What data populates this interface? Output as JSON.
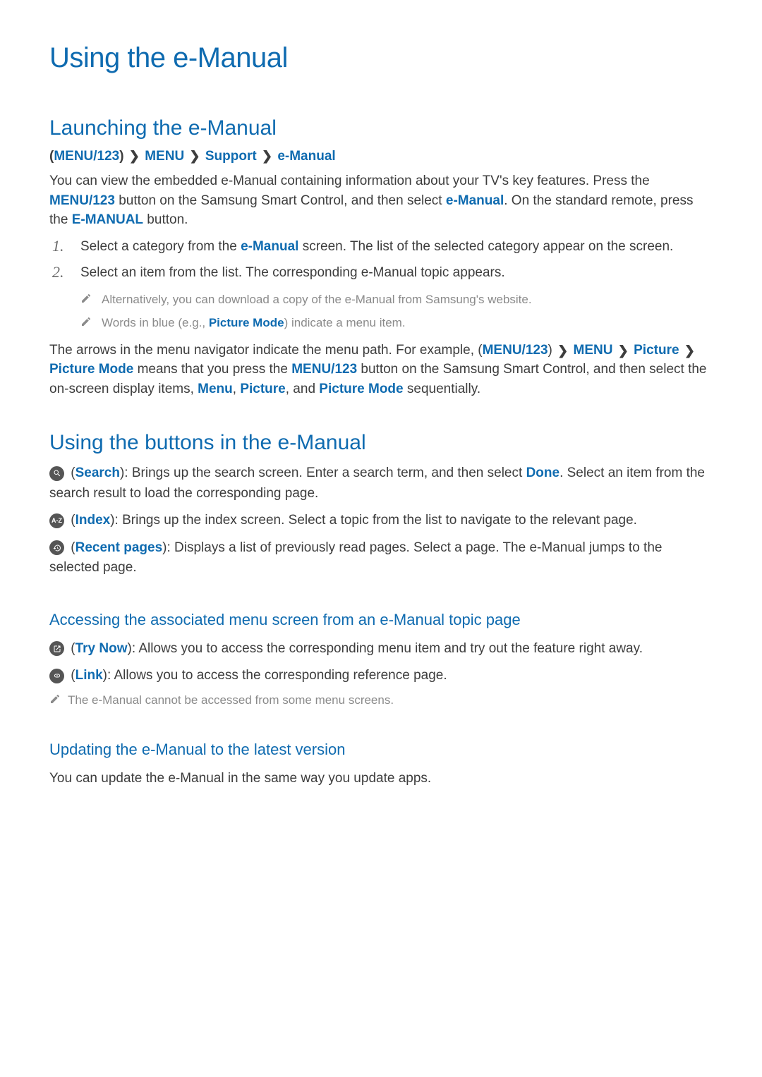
{
  "page_title": "Using the e-Manual",
  "section1": {
    "title": "Launching the e-Manual",
    "crumb": {
      "c1": "MENU/123",
      "c2": "MENU",
      "c3": "Support",
      "c4": "e-Manual"
    },
    "p1_a": "You can view the embedded e-Manual containing information about your TV's key features. Press the ",
    "p1_b": "MENU/123",
    "p1_c": " button on the Samsung Smart Control, and then select ",
    "p1_d": "e-Manual",
    "p1_e": ". On the standard remote, press the ",
    "p1_f": "E-MANUAL",
    "p1_g": " button.",
    "ol": {
      "n1": "1.",
      "t1a": "Select a category from the ",
      "t1b": "e-Manual",
      "t1c": " screen. The list of the selected category appear on the screen.",
      "n2": "2.",
      "t2": "Select an item from the list. The corresponding e-Manual topic appears."
    },
    "note1": "Alternatively, you can download a copy of the e-Manual from Samsung's website.",
    "note2a": "Words in blue (e.g., ",
    "note2b": "Picture Mode",
    "note2c": ") indicate a menu item.",
    "p2_a": "The arrows in the menu navigator indicate the menu path. For example, (",
    "p2_b": "MENU/123",
    "p2_c": ") ",
    "p2_d": "MENU",
    "p2_e": " ",
    "p2_f": "Picture",
    "p2_g": " ",
    "p2_h": "Picture Mode",
    "p2_i": " means that you press the ",
    "p2_j": "MENU/123",
    "p2_k": " button on the Samsung Smart Control, and then select the on-screen display items, ",
    "p2_l": "Menu",
    "p2_m": ", ",
    "p2_n": "Picture",
    "p2_o": ", and ",
    "p2_p": "Picture Mode",
    "p2_q": " sequentially."
  },
  "section2": {
    "title": "Using the buttons in the e-Manual",
    "search_label": "Search",
    "search_text_a": "): Brings up the search screen. Enter a search term, and then select ",
    "search_text_b": "Done",
    "search_text_c": ". Select an item from the search result to load the corresponding page.",
    "index_label": "Index",
    "index_text": "): Brings up the index screen. Select a topic from the list to navigate to the relevant page.",
    "recent_label": "Recent pages",
    "recent_text": "): Displays a list of previously read pages. Select a page. The e-Manual jumps to the selected page.",
    "sub1": {
      "title": "Accessing the associated menu screen from an e-Manual topic page",
      "trynow_label": "Try Now",
      "trynow_text": "): Allows you to access the corresponding menu item and try out the feature right away.",
      "link_label": "Link",
      "link_text": "): Allows you to access the corresponding reference page.",
      "note": "The e-Manual cannot be accessed from some menu screens."
    },
    "sub2": {
      "title": "Updating the e-Manual to the latest version",
      "text": "You can update the e-Manual in the same way you update apps."
    }
  },
  "icons": {
    "az_text": "A-Z"
  }
}
